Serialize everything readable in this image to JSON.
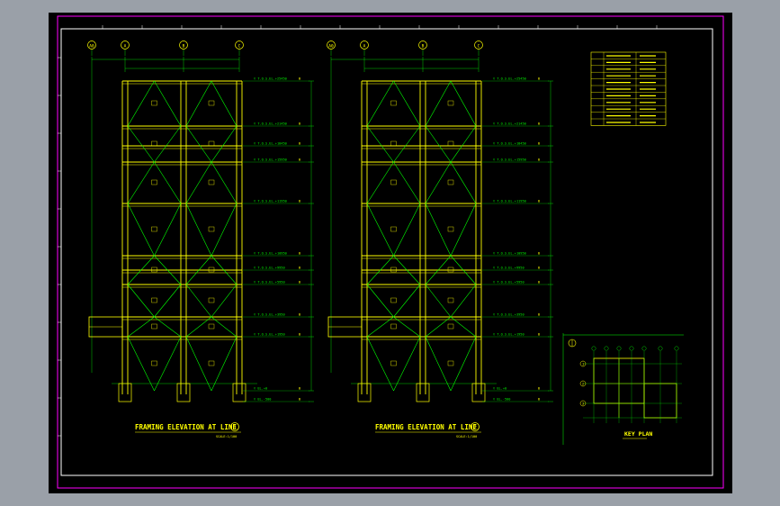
{
  "drawing": {
    "elevation_1": {
      "title": "FRAMING ELEVATION AT LINE",
      "line_number": "1",
      "scale": "SCALE:1/100",
      "grid_bubbles": [
        "A0",
        "A",
        "B",
        "C"
      ],
      "level_labels": [
        "▽ T.O.S.EL.+25450",
        "▽ T.O.S.EL.+21450",
        "▽ T.O.S.EL.+18450",
        "▽ T.O.S.EL.+15950",
        "▽ T.O.S.EL.+11950",
        "▽ T.O.S.EL.+10950",
        "▽ T.O.S.EL.+9950",
        "▽ T.O.S.EL.+5950",
        "▽ T.O.S.EL.+3950",
        "▽ T.O.S.EL.+1950",
        "▽ EL.+0",
        "▽ EL.-500"
      ]
    },
    "elevation_2": {
      "title": "FRAMING ELEVATION AT LINE",
      "line_number": "2",
      "scale": "SCALE:1/100",
      "grid_bubbles": [
        "A0",
        "A",
        "B",
        "C"
      ],
      "level_labels": [
        "▽ T.O.S.EL.+25450",
        "▽ T.O.S.EL.+21450",
        "▽ T.O.S.EL.+18450",
        "▽ T.O.S.EL.+15950",
        "▽ T.O.S.EL.+11950",
        "▽ T.O.S.EL.+10950",
        "▽ T.O.S.EL.+9950",
        "▽ T.O.S.EL.+5950",
        "▽ T.O.S.EL.+3950",
        "▽ T.O.S.EL.+1950",
        "▽ EL.+0",
        "▽ EL.-500"
      ]
    },
    "key_plan": {
      "title": "KEY PLAN",
      "row_bubbles": [
        "1",
        "2",
        "3"
      ]
    },
    "legend_table": {
      "rows": 11
    }
  },
  "colors": {
    "background": "#000000",
    "frame": "#ff00ff",
    "border": "#ffffff",
    "members": "#ffff00",
    "bracing": "#00ff00",
    "annotation": "#00ff00"
  }
}
